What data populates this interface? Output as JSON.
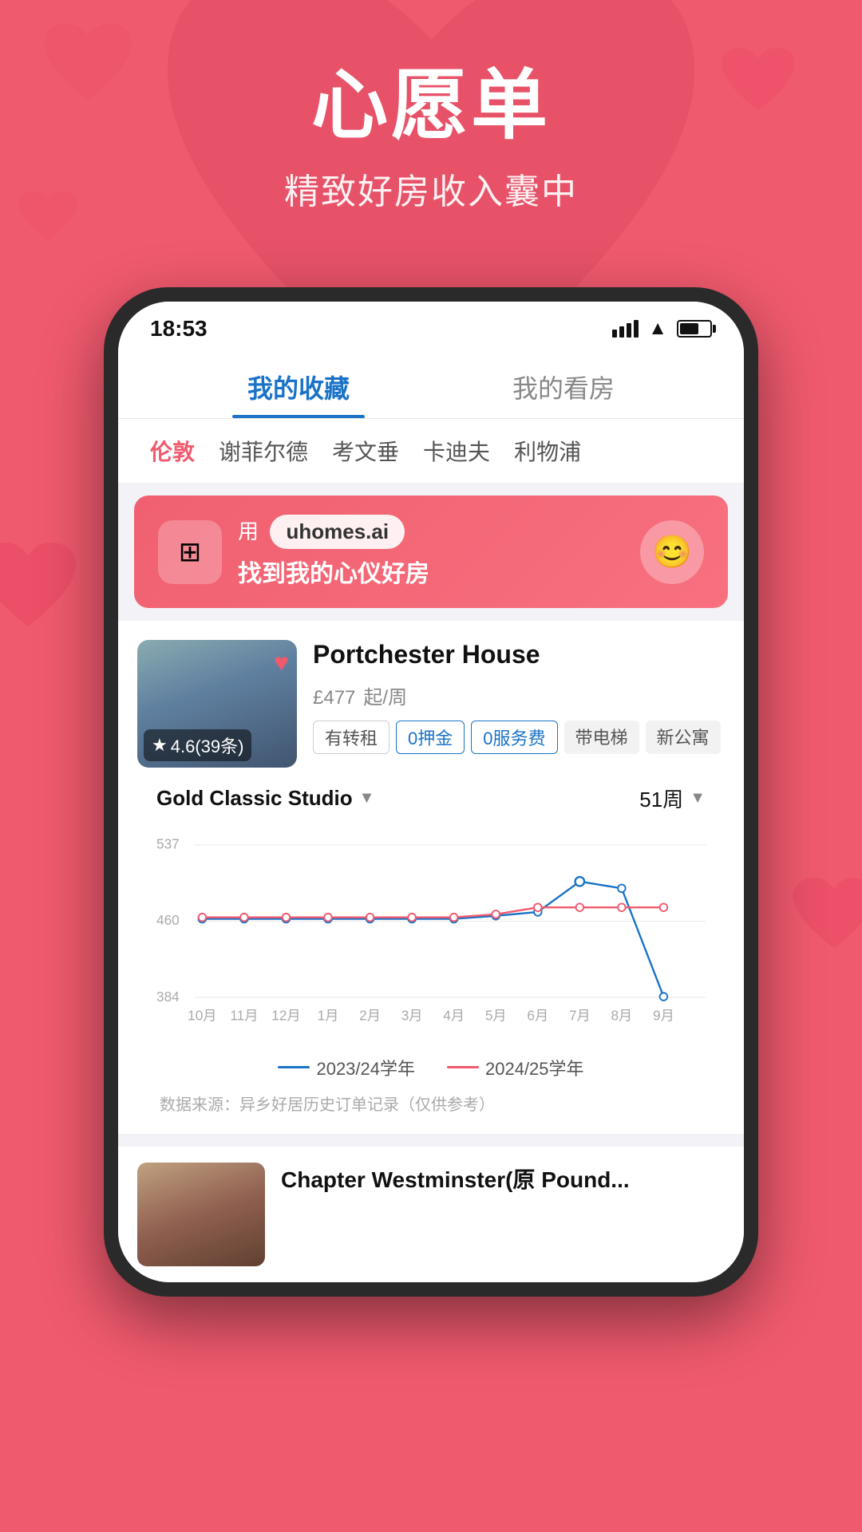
{
  "header": {
    "title": "心愿单",
    "subtitle": "精致好房收入囊中"
  },
  "phone": {
    "status_bar": {
      "time": "18:53"
    },
    "tabs": [
      {
        "id": "favorites",
        "label": "我的收藏",
        "active": true
      },
      {
        "id": "viewings",
        "label": "我的看房",
        "active": false
      }
    ],
    "city_filters": [
      {
        "id": "london",
        "label": "伦敦",
        "active": true
      },
      {
        "id": "sheffield",
        "label": "谢菲尔德",
        "active": false
      },
      {
        "id": "coventry",
        "label": "考文垂",
        "active": false
      },
      {
        "id": "cardiff",
        "label": "卡迪夫",
        "active": false
      },
      {
        "id": "liverpool",
        "label": "利物浦",
        "active": false
      }
    ],
    "banner": {
      "icon": "⊞",
      "url_text": "uhomes.ai",
      "tagline": "找到我的心仪好房",
      "robot_icon": "🤖"
    },
    "property1": {
      "name": "Portchester House",
      "price": "£477",
      "price_unit": "起/周",
      "rating": "4.6",
      "review_count": "39条",
      "tags": [
        {
          "label": "有转租",
          "type": "outline"
        },
        {
          "label": "0押金",
          "type": "blue-outline"
        },
        {
          "label": "0服务费",
          "type": "blue-outline"
        },
        {
          "label": "带电梯",
          "type": "gray"
        },
        {
          "label": "新公寓",
          "type": "gray"
        }
      ]
    },
    "chart": {
      "room_type": "Gold Classic Studio",
      "weeks": "51周",
      "y_labels": [
        "537",
        "460",
        "384"
      ],
      "x_labels": [
        "10月",
        "11月",
        "12月",
        "1月",
        "2月",
        "3月",
        "4月",
        "5月",
        "6月",
        "7月",
        "8月",
        "9月"
      ],
      "legend": [
        {
          "label": "2023/24学年",
          "color": "#1a73c7"
        },
        {
          "label": "2024/25学年",
          "color": "#F05A6E"
        }
      ],
      "source": "数据来源：异乡好居历史订单记录（仅供参考）",
      "series_2324": [
        460,
        460,
        460,
        460,
        460,
        460,
        460,
        463,
        470,
        520,
        510,
        385
      ],
      "series_2425": [
        462,
        462,
        462,
        462,
        462,
        462,
        462,
        465,
        472,
        472,
        472,
        472
      ]
    },
    "property2": {
      "name": "Chapter Westminster(原 Pound..."
    }
  }
}
